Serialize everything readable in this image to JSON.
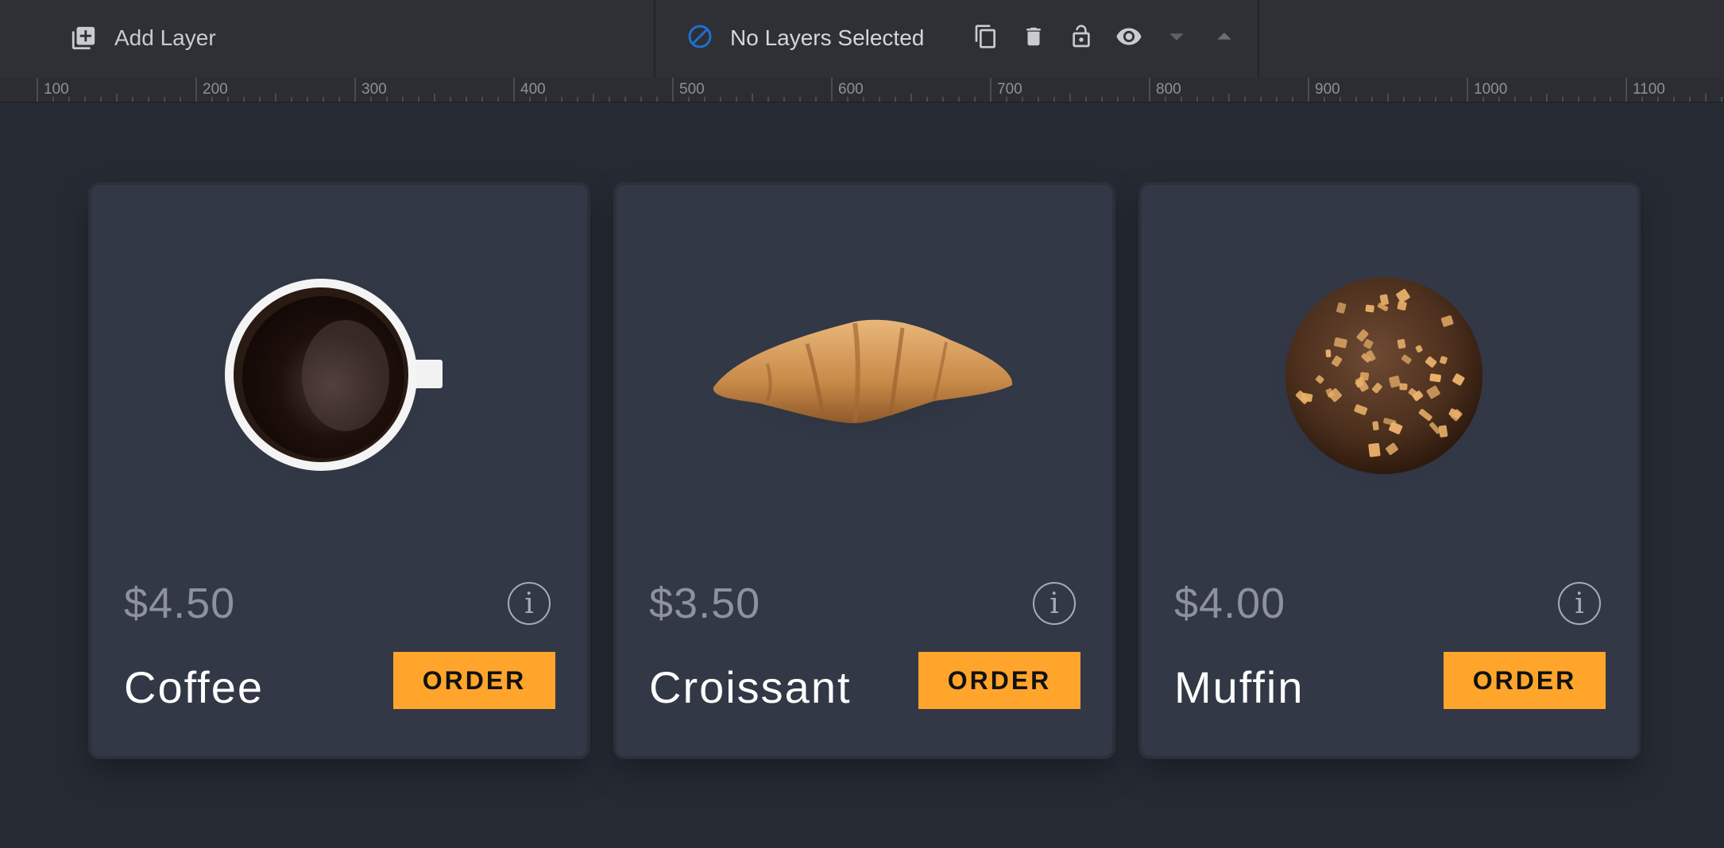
{
  "toolbar": {
    "add_layer_label": "Add Layer",
    "selection_status": "No Layers Selected",
    "icons": [
      "add-layer-icon",
      "no-selection-icon",
      "duplicate-icon",
      "delete-icon",
      "lock-icon",
      "visibility-icon",
      "move-down-icon",
      "move-up-icon"
    ]
  },
  "ruler": {
    "labels": [
      "100",
      "200",
      "300",
      "400",
      "500",
      "600",
      "700",
      "800",
      "900",
      "1000",
      "1100"
    ]
  },
  "products": [
    {
      "name": "Coffee",
      "price": "$4.50",
      "order_label": "ORDER",
      "info_label": "i"
    },
    {
      "name": "Croissant",
      "price": "$3.50",
      "order_label": "ORDER",
      "info_label": "i"
    },
    {
      "name": "Muffin",
      "price": "$4.00",
      "order_label": "ORDER",
      "info_label": "i"
    }
  ],
  "colors": {
    "accent": "#ffa52c",
    "card_bg": "#323846",
    "canvas_bg": "#262a33",
    "toolbar_bg": "#2f3035",
    "selection_icon": "#1f6fd1"
  }
}
